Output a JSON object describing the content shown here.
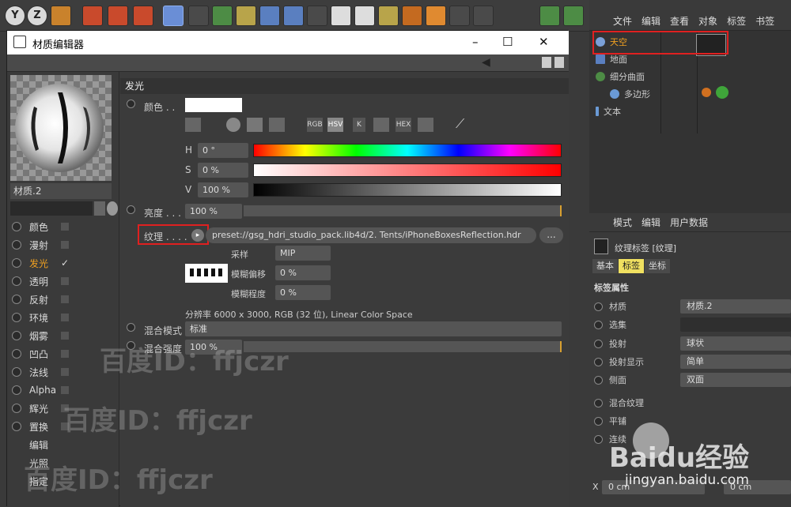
{
  "toolbar": {
    "icons": [
      "y-axis-icon",
      "z-axis-icon",
      "world-icon",
      "film-icon",
      "render-icon",
      "settings-render-icon",
      "cube-icon",
      "pen-icon",
      "generator-icon",
      "subdivide-icon",
      "deformer-icon",
      "floor-icon",
      "camera-icon",
      "light-icon",
      "tag-icon",
      "xpresso-icon",
      "sphere-icon",
      "s-icon",
      "download-icon",
      "sculpt-icon",
      "tree-icon",
      "tree2-icon"
    ],
    "y_label": "Y",
    "z_label": "Z"
  },
  "object_manager": {
    "menu": [
      "文件",
      "编辑",
      "查看",
      "对象",
      "标签",
      "书签"
    ],
    "objects": [
      {
        "name": "天空",
        "selected": true
      },
      {
        "name": "地面"
      },
      {
        "name": "细分曲面"
      },
      {
        "name": "多边形"
      },
      {
        "name": "文本"
      }
    ]
  },
  "attribute_manager": {
    "menu": [
      "模式",
      "编辑",
      "用户数据"
    ],
    "title": "纹理标签 [纹理]",
    "tabs": [
      "基本",
      "标签",
      "坐标"
    ],
    "section": "标签属性",
    "rows": [
      {
        "label": "材质",
        "value": "材质.2"
      },
      {
        "label": "选集",
        "value": ""
      },
      {
        "label": "投射",
        "value": "球状"
      },
      {
        "label": "投射显示",
        "value": "简单"
      },
      {
        "label": "侧面",
        "value": "双面"
      },
      {
        "label": "混合纹理",
        "value": ""
      },
      {
        "label": "平铺",
        "value": ""
      },
      {
        "label": "连续",
        "value": ""
      }
    ],
    "x_label": "X",
    "x_val": "0 cm",
    "x2_val": "0 cm"
  },
  "editor": {
    "title": "材质编辑器",
    "material_name": "材质.2",
    "channels": [
      "颜色",
      "漫射",
      "发光",
      "透明",
      "反射",
      "环境",
      "烟雾",
      "凹凸",
      "法线",
      "Alpha",
      "辉光",
      "置换",
      "编辑",
      "光照",
      "指定"
    ],
    "section": "发光",
    "color_label": "颜色 . .",
    "mode_buttons": [
      "RGB",
      "HSV",
      "K",
      "HEX"
    ],
    "h_label": "H",
    "h_val": "0 °",
    "s_label": "S",
    "s_val": "0 %",
    "v_label": "V",
    "v_val": "100 %",
    "brightness_label": "亮度 . . . .",
    "brightness_val": "100 %",
    "texture_label": "纹理 . . . .",
    "texture_path": "preset://gsg_hdri_studio_pack.lib4d/2. Tents/iPhoneBoxesReflection.hdr",
    "texture_more": "...",
    "sampling_label": "采样",
    "sampling_val": "MIP",
    "blur_offset_label": "模糊偏移",
    "blur_offset_val": "0 %",
    "blur_scale_label": "模糊程度",
    "blur_scale_val": "0 %",
    "resolution": "分辨率 6000 x 3000, RGB (32 位), Linear Color Space",
    "blend_mode_label": "混合模式",
    "blend_mode_val": "标准",
    "blend_strength_label": "混合强度",
    "blend_strength_val": "100 %"
  },
  "watermarks": [
    "百度ID：ffjczr",
    "百度ID：ffjczr",
    "百度ID：ffjczr"
  ],
  "baidu_logo": "Baidu经验",
  "baidu_url": "jingyan.baidu.com"
}
